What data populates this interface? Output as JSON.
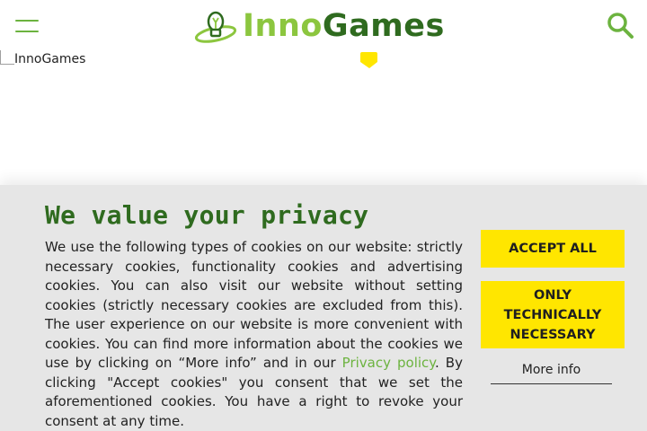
{
  "header": {
    "menu_icon": "hamburger-menu-icon",
    "logo": {
      "part1": "Inno",
      "part2": "Games"
    },
    "search_icon": "search-icon",
    "colors": {
      "accent": "#6cb33f",
      "logo_light": "#8cc63f",
      "logo_dark": "#2f6b1f"
    }
  },
  "hero": {
    "image_alt": "InnoGames"
  },
  "cookie_banner": {
    "title": "We value your privacy",
    "text_before_link": "We use the following types of cookies on our website: strictly necessary cookies, functionality cookies and advertising cookies. You can also visit our website without setting cookies (strictly necessary cookies are excluded from this). The user experience on our website is more convenient with cookies. You can find more information about the cookies we use by clicking on “More info” and in our ",
    "link_label": "Privacy policy",
    "text_after_link": ". By clicking \"Accept cookies\" you consent that we set the aforementioned cookies. You have a right to revoke your consent at any time.",
    "accept_all_label": "ACCEPT ALL",
    "only_necessary_label": "ONLY TECHNICALLY NECESSARY",
    "more_info_label": "More info",
    "colors": {
      "background": "#e6e6e6",
      "button": "#ffe600",
      "title": "#2f6b1f",
      "link": "#6cb33f"
    }
  }
}
